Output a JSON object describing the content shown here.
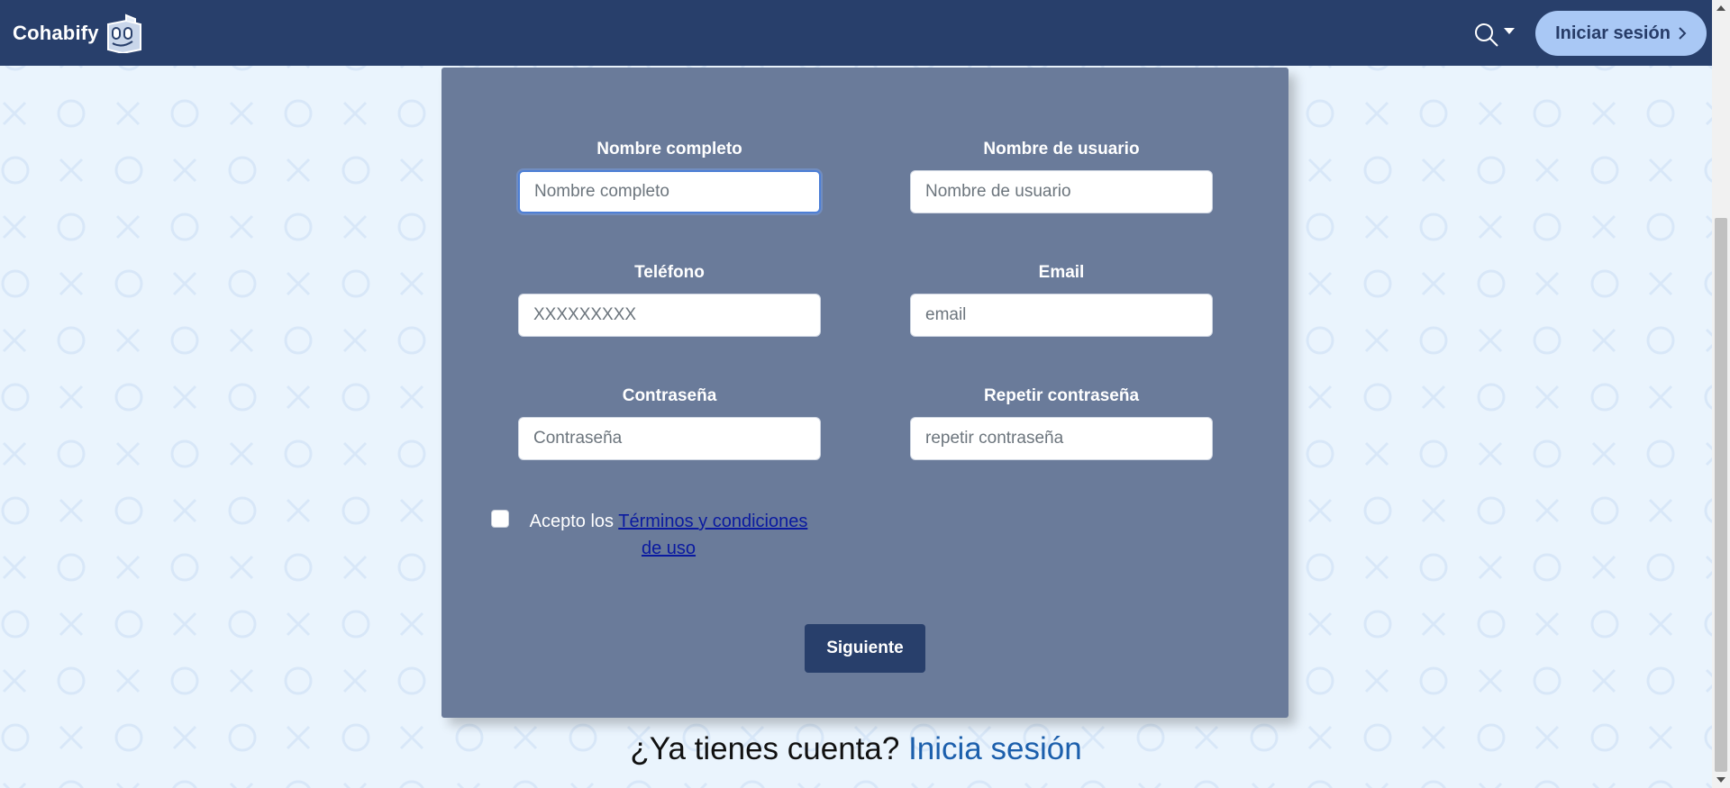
{
  "navbar": {
    "brand_name": "Cohabify",
    "logo_icon": "smiling-box-logo",
    "search_icon": "search-icon",
    "dropdown_icon": "caret-down-icon",
    "login_label": "Iniciar sesión",
    "login_icon": "chevron-right-icon",
    "background_color": "#283f6b",
    "login_button_color": "#a9c8f5"
  },
  "form": {
    "card_color": "#6a7b9a",
    "fields": [
      {
        "label": "Nombre completo",
        "placeholder": "Nombre completo",
        "value": ""
      },
      {
        "label": "Nombre de usuario",
        "placeholder": "Nombre de usuario",
        "value": ""
      },
      {
        "label": "Teléfono",
        "placeholder": "XXXXXXXXX",
        "value": ""
      },
      {
        "label": "Email",
        "placeholder": "email",
        "value": ""
      },
      {
        "label": "Contraseña",
        "placeholder": "Contraseña",
        "value": ""
      },
      {
        "label": "Repetir contraseña",
        "placeholder": "repetir contraseña",
        "value": ""
      }
    ],
    "terms_prefix": "Acepto los",
    "terms_link": "Términos y condiciones de uso",
    "terms_checked": false,
    "submit_label": "Siguiente",
    "submit_color": "#283f6b"
  },
  "footer": {
    "question": "¿Ya tienes cuenta?",
    "login_link": "Inicia sesión",
    "link_color": "#1c5fac"
  },
  "background": {
    "color": "#eaf4fd",
    "pattern": "tic-tac-toe x and o"
  }
}
